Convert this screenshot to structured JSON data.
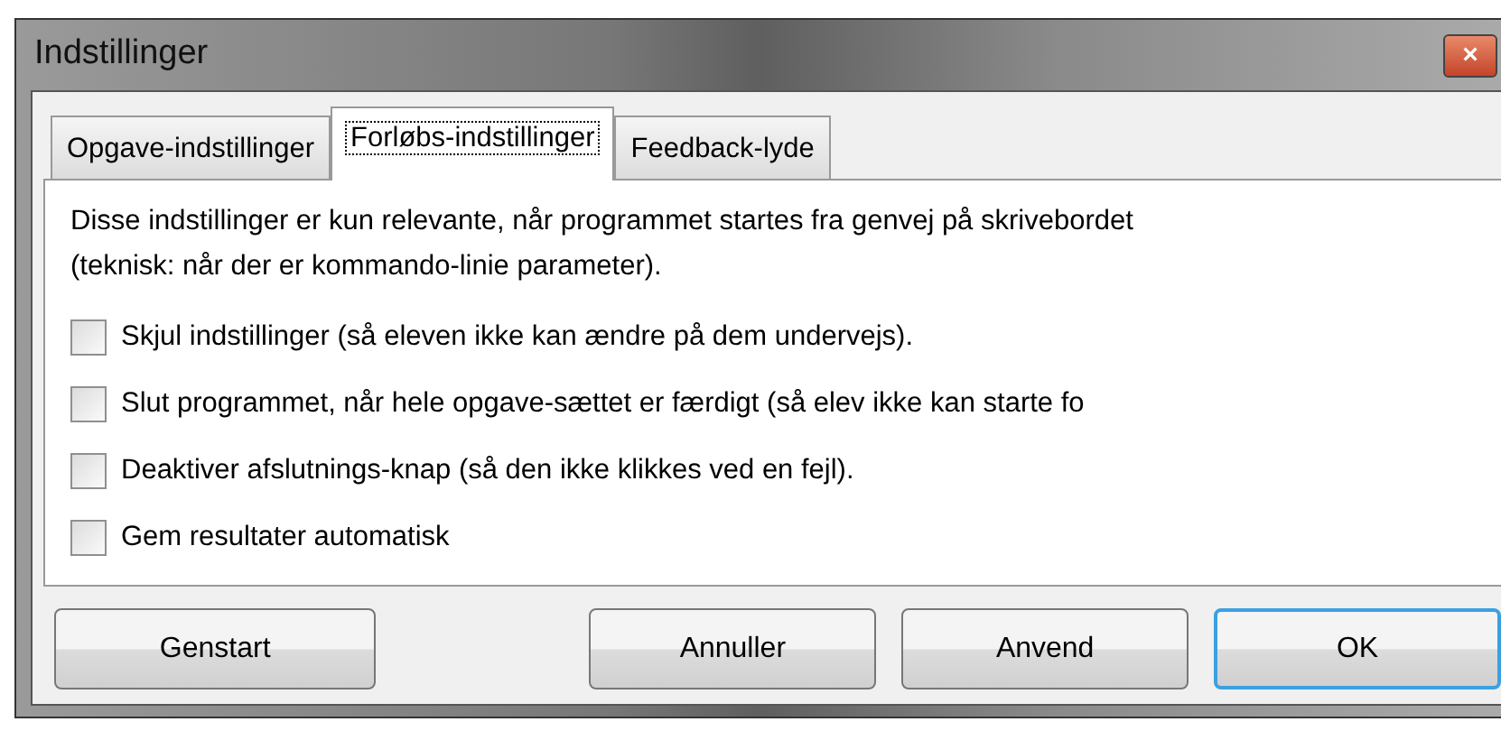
{
  "window": {
    "title": "Indstillinger",
    "close": "×"
  },
  "tabs": [
    {
      "label": "Opgave-indstillinger",
      "selected": false
    },
    {
      "label": "Forløbs-indstillinger",
      "selected": true
    },
    {
      "label": "Feedback-lyde",
      "selected": false
    }
  ],
  "description": "Disse indstillinger er kun relevante, når programmet startes fra genvej på skrivebordet (teknisk: når der er kommando-linie parameter).",
  "options": [
    {
      "label": "Skjul indstillinger (så eleven ikke kan ændre på dem undervejs).",
      "checked": false
    },
    {
      "label": "Slut programmet, når hele opgave-sættet er færdigt (så elev ikke kan starte fo",
      "checked": false
    },
    {
      "label": "Deaktiver afslutnings-knap (så den ikke klikkes ved en fejl).",
      "checked": false
    },
    {
      "label": "Gem resultater automatisk",
      "checked": false
    }
  ],
  "buttons": [
    {
      "label": "Genstart",
      "default": false
    },
    {
      "label": "Annuller",
      "default": false
    },
    {
      "label": "Anvend",
      "default": false
    },
    {
      "label": "OK",
      "default": true
    }
  ]
}
